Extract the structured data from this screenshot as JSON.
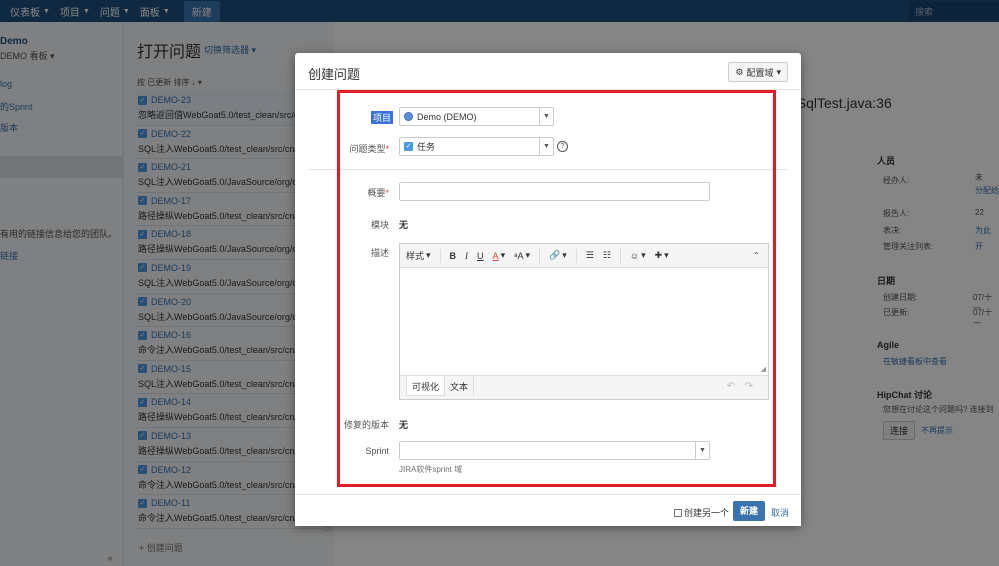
{
  "topnav": {
    "items": [
      "仪表板",
      "项目",
      "问题",
      "面板"
    ],
    "create": "新建",
    "search_placeholder": "搜索"
  },
  "sidebar": {
    "project": "Demo",
    "board": "DEMO 看板",
    "links": [
      "log",
      "的Sprint",
      "版本"
    ],
    "note": "有用的链接信息给您的团队。",
    "note_link": "链接"
  },
  "issuelist": {
    "title": "打开问题",
    "switch_filter": "切换筛选器",
    "sort_label": "按 已更新 排序",
    "create_issue": "+ 创建问题",
    "rows": [
      {
        "key": "DEMO-23",
        "summary": "忽略返回值WebGoat5.0/test_clean/src/cn/"
      },
      {
        "key": "DEMO-22",
        "summary": "SQL注入WebGoat5.0/test_clean/src/cn/c"
      },
      {
        "key": "DEMO-21",
        "summary": "SQL注入WebGoat5.0/JavaSource/org/ow"
      },
      {
        "key": "DEMO-17",
        "summary": "路径操纵WebGoat5.0/test_clean/src/cn/"
      },
      {
        "key": "DEMO-18",
        "summary": "路径操纵WebGoat5.0/JavaSource/org/ow"
      },
      {
        "key": "DEMO-19",
        "summary": "SQL注入WebGoat5.0/JavaSource/org/ow"
      },
      {
        "key": "DEMO-20",
        "summary": "SQL注入WebGoat5.0/JavaSource/org/ow"
      },
      {
        "key": "DEMO-16",
        "summary": "命令注入WebGoat5.0/test_clean/src/cn/"
      },
      {
        "key": "DEMO-15",
        "summary": "SQL注入WebGoat5.0/test_clean/src/cn/c"
      },
      {
        "key": "DEMO-14",
        "summary": "路径操纵WebGoat5.0/test_clean/src/cn/"
      },
      {
        "key": "DEMO-13",
        "summary": "路径操纵WebGoat5.0/test_clean/src/cn/"
      },
      {
        "key": "DEMO-12",
        "summary": "命令注入WebGoat5.0/test_clean/src/cn/"
      },
      {
        "key": "DEMO-11",
        "summary": "命令注入WebGoat5.0/test_clean/src/cn/"
      }
    ]
  },
  "detail": {
    "title_fragment": "t/SqlTest.java:36",
    "people_head": "人员",
    "assignee_label": "经办人:",
    "assignee_val": "未",
    "assign_to_me": "分配给",
    "reporter_label": "报告人:",
    "reporter_val": "22",
    "votes_label": "表决:",
    "votes_val": "为此",
    "watchers_label": "管理关注列表:",
    "watchers_val": "开",
    "dates_head": "日期",
    "created_label": "创建日期:",
    "created_val": "07/十一",
    "updated_label": "已更新:",
    "updated_val": "07/十一",
    "agile_head": "Agile",
    "agile_link": "在敏捷看板中查看",
    "hipchat_head": "HipChat 讨论",
    "hipchat_text": "您想在讨论这个问题吗? 连接到",
    "connect_btn": "连接",
    "no_remind": "不再提示"
  },
  "dialog": {
    "title": "创建问题",
    "configure": "配置域",
    "project_label": "项目",
    "project_value": "Demo (DEMO)",
    "issuetype_label": "问题类型",
    "issuetype_value": "任务",
    "summary_label": "概要",
    "component_label": "模块",
    "component_value": "无",
    "description_label": "描述",
    "toolbar": {
      "style": "样式",
      "bold": "B",
      "italic": "I",
      "underline": "U",
      "color": "A",
      "more_text": "ᵃA",
      "link": "🔗",
      "bullet": "☰",
      "numbered": "☷",
      "emoji": "☺",
      "insert": "✚",
      "collapse": "⌃"
    },
    "tab_visual": "可视化",
    "tab_text": "文本",
    "fixversion_label": "修复的版本",
    "fixversion_value": "无",
    "sprint_label": "Sprint",
    "sprint_hint": "JIRA软件sprint 域",
    "create_another": "创建另一个",
    "create_btn": "新建",
    "cancel": "取消"
  },
  "colors": {
    "nav": "#205081",
    "accent": "#3b73af",
    "highlight": "#e01c24"
  }
}
